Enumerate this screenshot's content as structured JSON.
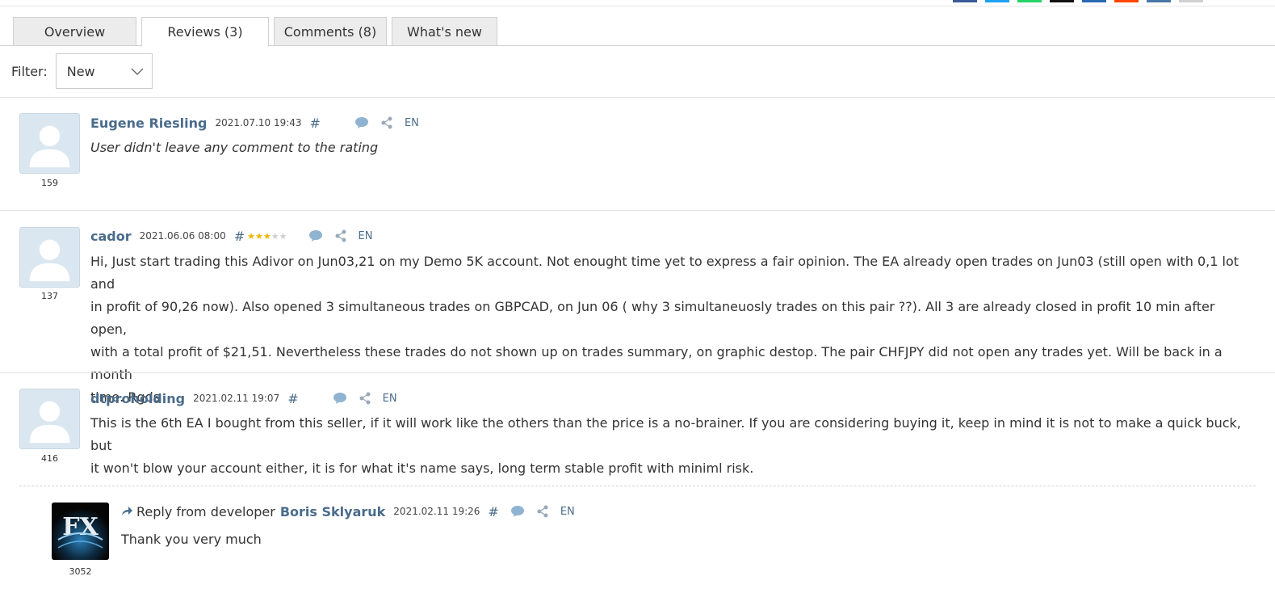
{
  "tabs": [
    {
      "label": "Overview",
      "active": false
    },
    {
      "label": "Reviews (3)",
      "active": true
    },
    {
      "label": "Comments (8)",
      "active": false
    },
    {
      "label": "What's new",
      "active": false
    }
  ],
  "filter": {
    "label": "Filter:",
    "selected": "New"
  },
  "reviews": [
    {
      "author": "Eugene Riesling",
      "date": "2021.07.10 19:43",
      "hash": "#",
      "rating_number": "159",
      "stars": null,
      "language": "EN",
      "text": "User didn't leave any comment to the rating"
    },
    {
      "author": "cador",
      "date": "2021.06.06 08:00",
      "hash": "#",
      "rating_number": "137",
      "stars": 3,
      "stars_max": 5,
      "language": "EN",
      "text_lines": [
        "Hi, Just start trading this Adivor on Jun03,21 on my Demo 5K account. Not enought time yet to express a fair opinion. The EA already open trades on Jun03 (still open with 0,1 lot and",
        "in profit of 90,26 now). Also opened 3 simultaneous trades on GBPCAD, on Jun 06 ( why 3 simultaneuosly trades on this pair ??). All 3 are already closed in profit 10 min after open,",
        "with a total profit of $21,51. Nevertheless these trades do not shown up on trades summary, on graphic destop. The pair CHFJPY did not open any trades yet. Will be back in a month",
        "time. Rgds"
      ]
    },
    {
      "author": "dtproholding",
      "date": "2021.02.11 19:07",
      "hash": "#",
      "rating_number": "416",
      "stars": null,
      "language": "EN",
      "text_lines": [
        "This is the 6th EA I bought from this seller, if it will work like the others than the price is a no-brainer. If you are considering buying it, keep in mind it is not to make a quick buck, but",
        "it won't blow your account either, it is for what it's name says, long term stable profit with miniml risk."
      ]
    }
  ],
  "reply": {
    "label": "Reply from developer",
    "author": "Boris Sklyaruk",
    "date": "2021.02.11 19:26",
    "hash": "#",
    "language": "EN",
    "rating_number": "3052",
    "text": "Thank you very much"
  },
  "colors": {
    "link": "#4a6c8c",
    "star_on": "#f0b400",
    "star_off": "#cfcfcf",
    "tab_bg": "#ececec",
    "avatar_bg": "#dbe7f0"
  },
  "icons": [
    "chevron-down-icon",
    "comment-bubble-icon",
    "share-icon",
    "reply-arrow-icon",
    "default-avatar-icon",
    "developer-logo"
  ]
}
